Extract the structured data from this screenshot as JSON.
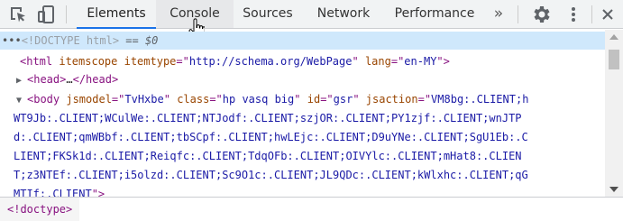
{
  "tabs": [
    {
      "label": "Elements"
    },
    {
      "label": "Console"
    },
    {
      "label": "Sources"
    },
    {
      "label": "Network"
    },
    {
      "label": "Performance"
    }
  ],
  "more_tabs": "»",
  "icons": {
    "inspect": "cursor-arrow-box-icon",
    "device": "device-toggle-icon",
    "settings": "gear-icon",
    "menu": "kebab-menu-icon"
  },
  "colors": {
    "accent": "#1a73e8",
    "selected_row": "#cfe8fc",
    "tag": "#881280",
    "attr": "#994500",
    "value": "#1a1aa6"
  },
  "tree": {
    "doctype": {
      "dots": "•••",
      "text": "<!DOCTYPE html>",
      "suffix": " == $0"
    },
    "html_line": {
      "open": "<html",
      "a1": " itemscope",
      "a2": " itemtype",
      "eq2": "=\"",
      "v2": "http://schema.org/WebPage",
      "q2": "\"",
      "a3": " lang",
      "eq3": "=\"",
      "v3": "en-MY",
      "close": "\">"
    },
    "head_line": {
      "arrow": "▶",
      "open": "<head>",
      "ellipsis": "…",
      "close": "</head>"
    },
    "body_line": {
      "arrow": "▼",
      "open": "<body",
      "a1": " jsmodel",
      "eq1": "=\"",
      "v1": "TvHxbe",
      "q1": "\"",
      "a2": " class",
      "eq2": "=\"",
      "v2": "hp vasq big",
      "q2": "\"",
      "a3": " id",
      "eq3": "=\"",
      "v3": "gsr",
      "q3": "\"",
      "a4": " jsaction",
      "eq4": "=\"",
      "v4a": "VM8bg:.CLIENT;h"
    },
    "jsaction_lines": [
      "WT9Jb:.CLIENT;WCulWe:.CLIENT;NTJodf:.CLIENT;szjOR:.CLIENT;PY1zjf:.CLIENT;wnJTP",
      "d:.CLIENT;qmWBbf:.CLIENT;tbSCpf:.CLIENT;hwLEjc:.CLIENT;D9uYNe:.CLIENT;SgU1Eb:.C",
      "LIENT;FKSk1d:.CLIENT;Reiqfc:.CLIENT;TdqOFb:.CLIENT;OIVYlc:.CLIENT;mHat8:.CLIEN",
      "T;z3NTEf:.CLIENT;i5olzd:.CLIENT;Sc9O1c:.CLIENT;JL9QDc:.CLIENT;kWlxhc:.CLIENT;qG"
    ],
    "jsaction_last": "MTIf:.CLIENT",
    "body_close": "\">"
  },
  "breadcrumb": {
    "label": "<!doctype>"
  }
}
